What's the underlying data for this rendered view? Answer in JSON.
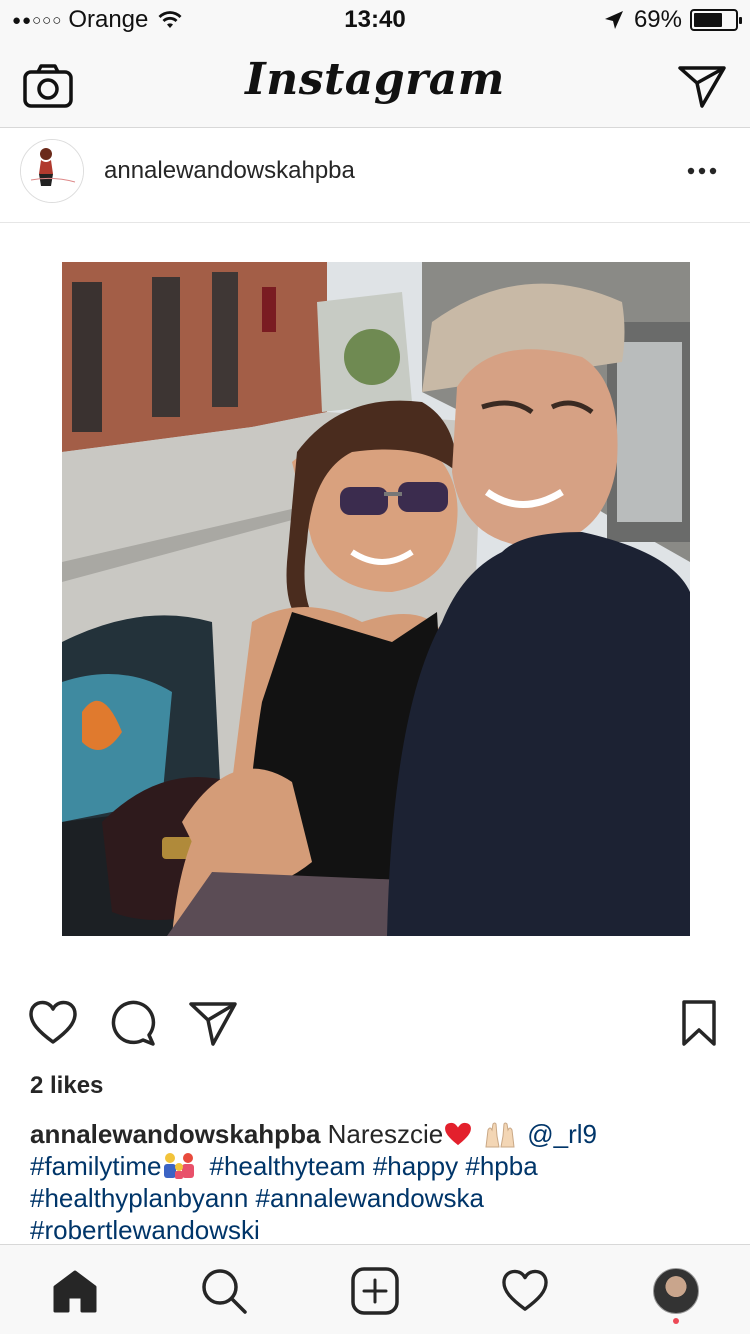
{
  "status_bar": {
    "signal": "●●○○○",
    "carrier": "Orange",
    "time": "13:40",
    "battery_text": "69%",
    "battery_level": 0.69
  },
  "header": {
    "brand": "Instagram",
    "camera_icon": "camera-icon",
    "direct_icon": "paper-plane-icon"
  },
  "post": {
    "username": "annalewandowskahpba",
    "more_icon": "more-dots-icon",
    "likes": "2 likes",
    "caption": {
      "username": "annalewandowskahpba",
      "text": "Nareszcie",
      "mention": "@_rl9",
      "tag1": "#familytime",
      "tag2": "#healthyteam",
      "tag3": "#happy",
      "tag4": "#hpba",
      "tag5": "#healthyplanbyann",
      "tag6": "#annalewandowska",
      "tag7": "#robertlewandowski"
    }
  },
  "actions": {
    "like_icon": "heart-icon",
    "comment_icon": "comment-icon",
    "share_icon": "paper-plane-icon",
    "save_icon": "bookmark-icon"
  },
  "tab_bar": {
    "items": [
      "home-icon",
      "search-icon",
      "add-icon",
      "heart-icon",
      "profile-avatar"
    ]
  },
  "colors": {
    "hashtag": "#003569",
    "text": "#262626",
    "bar_background": "#f8f8f8",
    "notification_dot": "#ed4956"
  }
}
